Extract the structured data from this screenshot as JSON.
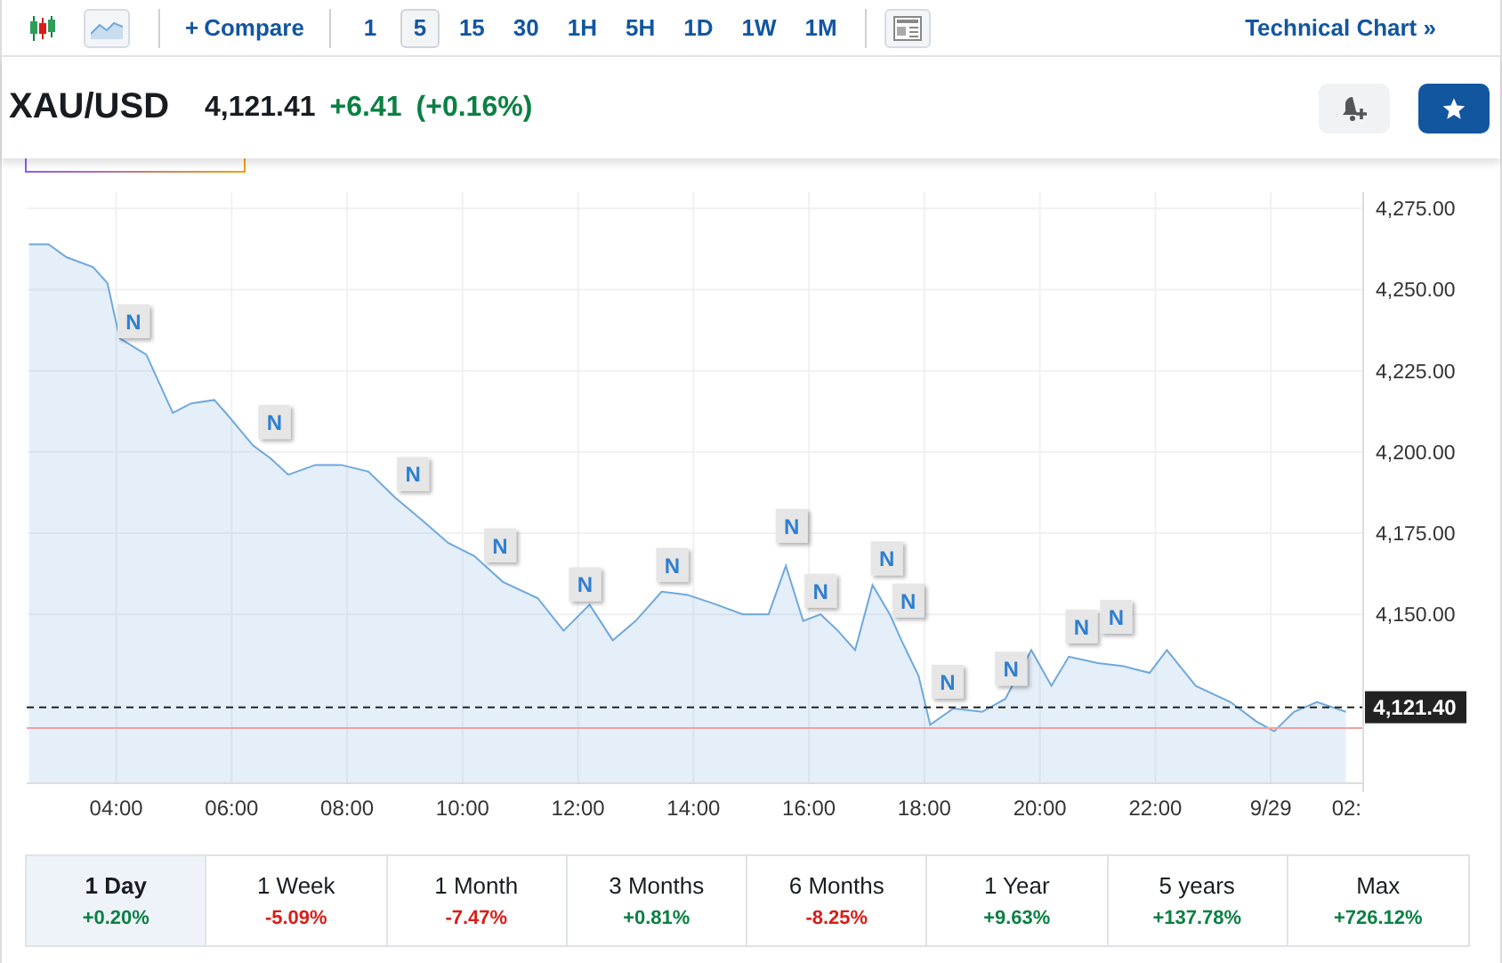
{
  "toolbar": {
    "chart_types": [
      {
        "kind": "candles",
        "selected": false
      },
      {
        "kind": "area",
        "selected": true
      }
    ],
    "compare": {
      "icon": "+",
      "label": "Compare"
    },
    "intervals": [
      {
        "label": "1",
        "selected": false
      },
      {
        "label": "5",
        "selected": true
      },
      {
        "label": "15",
        "selected": false
      },
      {
        "label": "30",
        "selected": false
      },
      {
        "label": "1H",
        "selected": false
      },
      {
        "label": "5H",
        "selected": false
      },
      {
        "label": "1D",
        "selected": false
      },
      {
        "label": "1W",
        "selected": false
      },
      {
        "label": "1M",
        "selected": false
      }
    ],
    "technical_chart": {
      "label": "Technical Chart",
      "arrow": "»"
    }
  },
  "quote": {
    "symbol": "XAU/USD",
    "price": "4,121.41",
    "change": "+6.41",
    "change_percent": "(+0.16%)",
    "color": "#0a8043"
  },
  "chart": {
    "last_price_label": "4,121.40",
    "cut_axis_label": "02:",
    "chart_data": {
      "type": "area",
      "xlim": [
        2.45,
        25.6
      ],
      "ylim": [
        4098,
        4280
      ],
      "grid": true,
      "ref_lines": [
        {
          "axis": "y",
          "value": 4121.4,
          "color": "#222222"
        },
        {
          "axis": "y",
          "value": 4115,
          "color": "#f2a0a0"
        }
      ],
      "x": [
        2.49,
        2.83,
        3.14,
        3.6,
        3.85,
        4.06,
        4.52,
        4.98,
        5.3,
        5.7,
        5.9,
        6.37,
        6.68,
        6.98,
        7.45,
        7.9,
        8.37,
        8.83,
        9.3,
        9.75,
        10.2,
        10.7,
        11.3,
        11.75,
        12.2,
        12.6,
        13.0,
        13.45,
        13.9,
        14.4,
        14.85,
        15.3,
        15.6,
        15.9,
        16.2,
        16.5,
        16.8,
        17.1,
        17.4,
        17.6,
        17.9,
        18.1,
        18.5,
        19.0,
        19.4,
        19.85,
        20.2,
        20.5,
        21.0,
        21.45,
        21.9,
        22.2,
        22.7,
        23.3,
        23.75,
        24.06,
        24.4,
        24.8,
        25.3
      ],
      "series": [
        {
          "color": "#6fa8dc",
          "values": [
            4264,
            4264,
            4260,
            4257,
            4252,
            4235,
            4230,
            4212,
            4215,
            4216,
            4212,
            4202,
            4198,
            4193,
            4196,
            4196,
            4194,
            4186,
            4179,
            4172,
            4168,
            4160,
            4155,
            4145,
            4153,
            4142,
            4148,
            4157,
            4156,
            4153,
            4150,
            4150,
            4165,
            4148,
            4150,
            4145,
            4139,
            4159,
            4150,
            4142,
            4131,
            4116,
            4121,
            4120,
            4124,
            4139,
            4128,
            4137,
            4135,
            4134,
            4132,
            4139,
            4128,
            4123,
            4117,
            4114,
            4120,
            4123,
            4120
          ]
        }
      ],
      "xticks": [
        {
          "value": 4,
          "label": "04:00"
        },
        {
          "value": 6,
          "label": "06:00"
        },
        {
          "value": 8,
          "label": "08:00"
        },
        {
          "value": 10,
          "label": "10:00"
        },
        {
          "value": 12,
          "label": "12:00"
        },
        {
          "value": 14,
          "label": "14:00"
        },
        {
          "value": 16,
          "label": "16:00"
        },
        {
          "value": 18,
          "label": "18:00"
        },
        {
          "value": 20,
          "label": "20:00"
        },
        {
          "value": 22,
          "label": "22:00"
        },
        {
          "value": 24,
          "label": "9/29"
        }
      ],
      "yticks": [
        {
          "value": 4150,
          "label": "4,150.00"
        },
        {
          "value": 4175,
          "label": "4,175.00"
        },
        {
          "value": 4200,
          "label": "4,200.00"
        },
        {
          "value": 4225,
          "label": "4,225.00"
        },
        {
          "value": 4250,
          "label": "4,250.00"
        },
        {
          "value": 4275,
          "label": "4,275.00"
        }
      ],
      "annotations": [
        {
          "x": 4.3,
          "y": 4240,
          "text": "N"
        },
        {
          "x": 6.74,
          "y": 4209,
          "text": "N"
        },
        {
          "x": 9.14,
          "y": 4193,
          "text": "N"
        },
        {
          "x": 10.65,
          "y": 4171,
          "text": "N"
        },
        {
          "x": 12.12,
          "y": 4159,
          "text": "N"
        },
        {
          "x": 13.63,
          "y": 4165,
          "text": "N"
        },
        {
          "x": 15.7,
          "y": 4177,
          "text": "N"
        },
        {
          "x": 16.2,
          "y": 4157,
          "text": "N"
        },
        {
          "x": 17.35,
          "y": 4167,
          "text": "N"
        },
        {
          "x": 17.72,
          "y": 4154,
          "text": "N"
        },
        {
          "x": 18.4,
          "y": 4129,
          "text": "N"
        },
        {
          "x": 19.5,
          "y": 4133,
          "text": "N"
        },
        {
          "x": 20.72,
          "y": 4146,
          "text": "N"
        },
        {
          "x": 21.32,
          "y": 4149,
          "text": "N"
        }
      ]
    }
  },
  "periods": [
    {
      "label": "1 Day",
      "change": "+0.20%",
      "color": "#0a8043",
      "selected": true
    },
    {
      "label": "1 Week",
      "change": "-5.09%",
      "color": "#d91e18",
      "selected": false
    },
    {
      "label": "1 Month",
      "change": "-7.47%",
      "color": "#d91e18",
      "selected": false
    },
    {
      "label": "3 Months",
      "change": "+0.81%",
      "color": "#0a8043",
      "selected": false
    },
    {
      "label": "6 Months",
      "change": "-8.25%",
      "color": "#d91e18",
      "selected": false
    },
    {
      "label": "1 Year",
      "change": "+9.63%",
      "color": "#0a8043",
      "selected": false
    },
    {
      "label": "5 years",
      "change": "+137.78%",
      "color": "#0a8043",
      "selected": false
    },
    {
      "label": "Max",
      "change": "+726.12%",
      "color": "#0a8043",
      "selected": false
    }
  ]
}
